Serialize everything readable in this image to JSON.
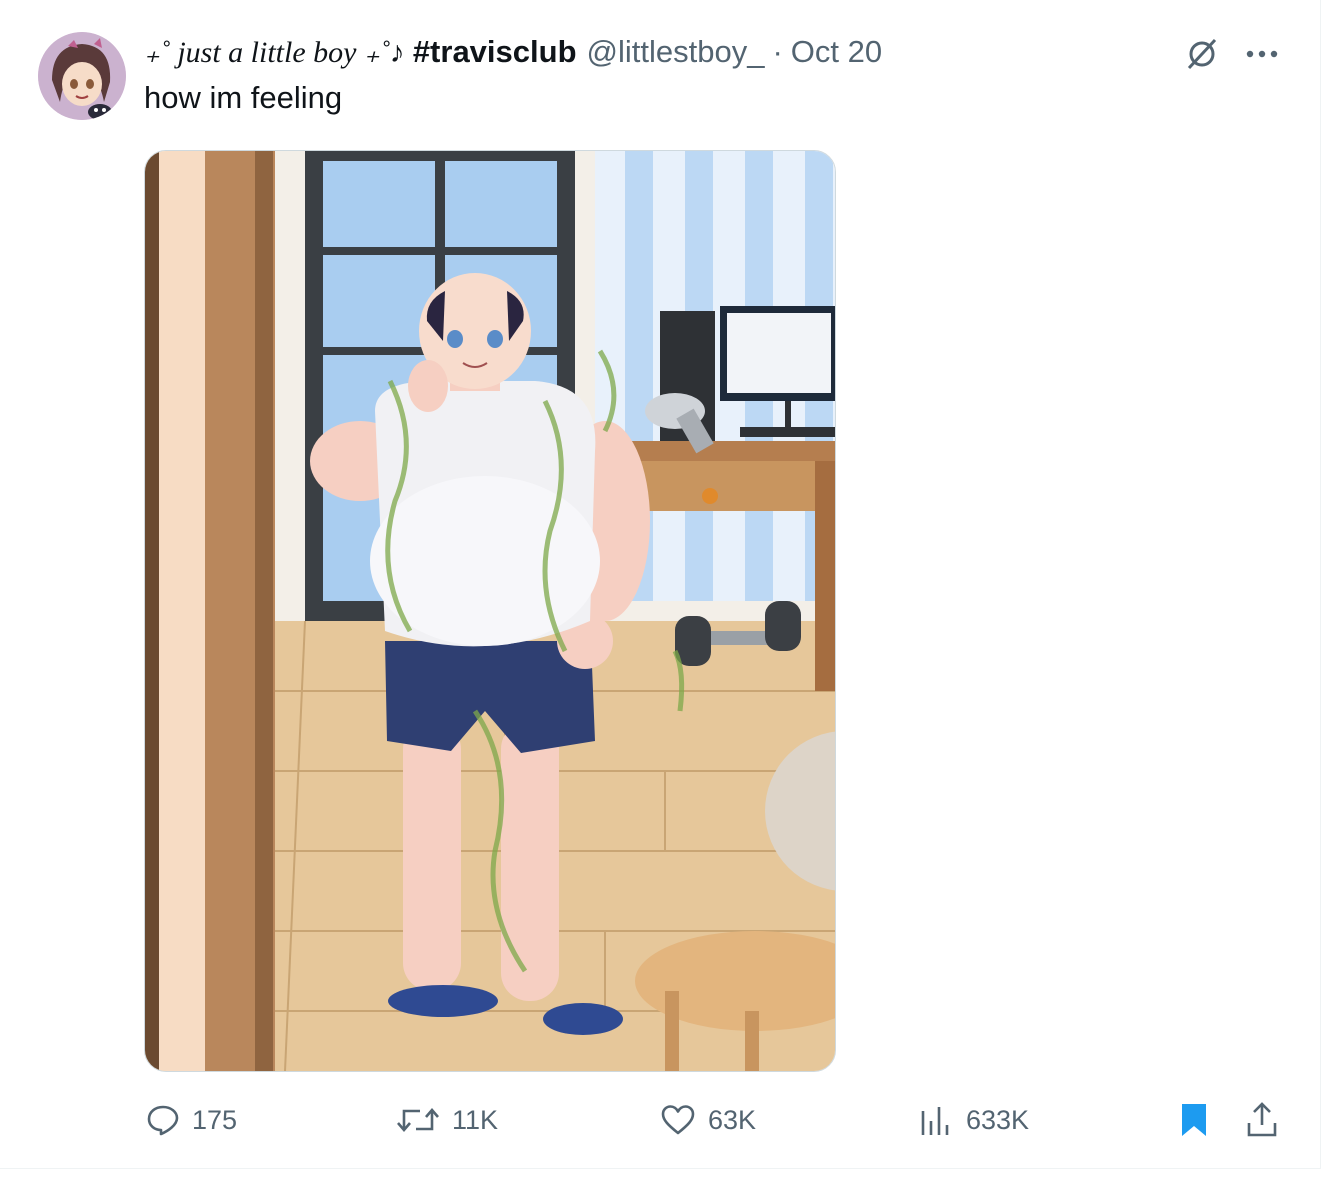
{
  "tweet": {
    "display_name": "₊˚ just a little boy ₊˚♪",
    "hashtag": "#travisclub",
    "handle": "@littlestboy_",
    "separator": "·",
    "date": "Oct 20",
    "text": "how im feeling"
  },
  "actions": {
    "replies": "175",
    "reposts": "11K",
    "likes": "63K",
    "views": "633K"
  },
  "icons": {
    "avatar": "avatar",
    "grok": "grok-icon",
    "more": "more-icon",
    "reply": "reply-icon",
    "repost": "repost-icon",
    "like": "heart-icon",
    "views": "views-icon",
    "bookmark": "bookmark-icon",
    "share": "share-icon"
  },
  "colors": {
    "text": "#0f1419",
    "secondary": "#536471",
    "bookmark": "#1d9bf0",
    "border": "#cfd9de"
  }
}
